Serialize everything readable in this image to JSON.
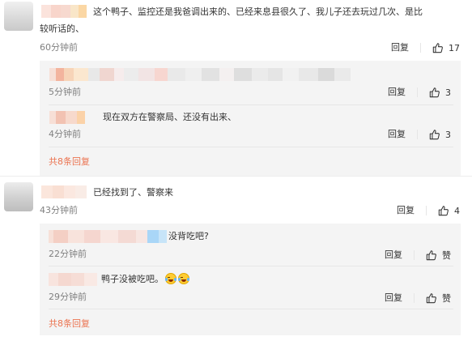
{
  "comment1": {
    "text_line1": "这个鸭子、监控还是我爸调出来的、已经来息县很久了、我儿子还去玩过几次、是比",
    "text_line2": "较听话的、",
    "time": "60分钟前",
    "reply_label": "回复",
    "likes": "17",
    "replies": [
      {
        "time": "5分钟前",
        "reply_label": "回复",
        "likes": "3"
      },
      {
        "text": "现在双方在警察局、还没有出来、",
        "time": "4分钟前",
        "reply_label": "回复",
        "likes": "3"
      }
    ],
    "more_label": "共8条回复"
  },
  "comment2": {
    "text": "已经找到了、警察来",
    "time": "43分钟前",
    "reply_label": "回复",
    "likes": "4",
    "replies": [
      {
        "text": "没背吃吧?",
        "time": "22分钟前",
        "reply_label": "回复",
        "like_label": "赞"
      },
      {
        "text": "鸭子没被吃吧。",
        "time": "29分钟前",
        "reply_label": "回复",
        "like_label": "赞"
      }
    ],
    "more_label": "共8条回复"
  },
  "icons": {
    "like": "thumbs-up-icon",
    "emoji": "laughing-tears-emoji"
  },
  "colors": {
    "more_link": "#eb7350",
    "panel_bg": "#f4f4f4",
    "time_gray": "#808080"
  }
}
